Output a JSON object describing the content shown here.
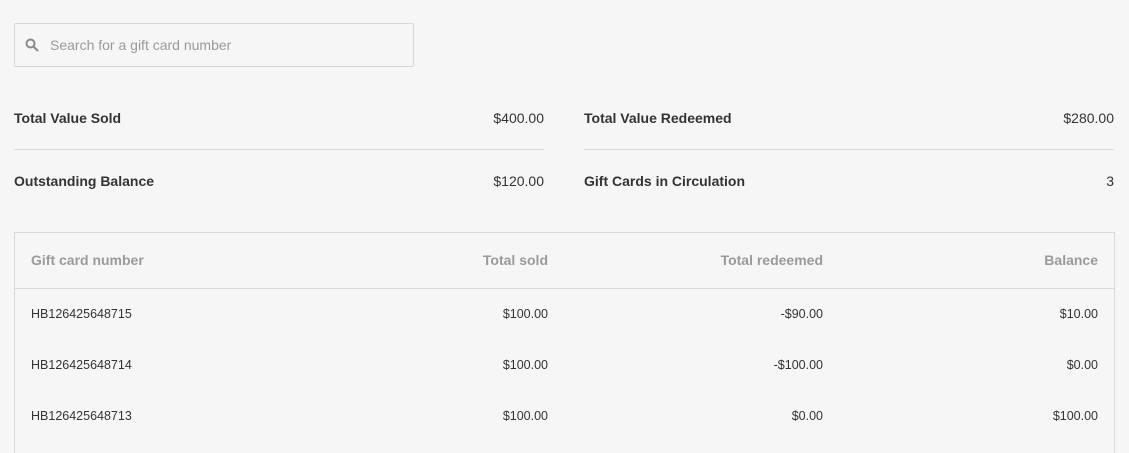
{
  "search": {
    "placeholder": "Search for a gift card number"
  },
  "stats": {
    "total_value_sold": {
      "label": "Total Value Sold",
      "value": "$400.00"
    },
    "total_value_redeemed": {
      "label": "Total Value Redeemed",
      "value": "$280.00"
    },
    "outstanding_balance": {
      "label": "Outstanding Balance",
      "value": "$120.00"
    },
    "gift_cards_in_circulation": {
      "label": "Gift Cards in Circulation",
      "value": "3"
    }
  },
  "table": {
    "headers": {
      "number": "Gift card number",
      "sold": "Total sold",
      "redeemed": "Total redeemed",
      "balance": "Balance"
    },
    "rows": [
      {
        "number": "HB126425648715",
        "sold": "$100.00",
        "redeemed": "-$90.00",
        "balance": "$10.00"
      },
      {
        "number": "HB126425648714",
        "sold": "$100.00",
        "redeemed": "-$100.00",
        "balance": "$0.00"
      },
      {
        "number": "HB126425648713",
        "sold": "$100.00",
        "redeemed": "$0.00",
        "balance": "$100.00"
      }
    ]
  },
  "icons": {
    "search": "search-icon"
  },
  "colors": {
    "background": "#f6f6f6",
    "text": "#333333",
    "muted": "#9a9a9a",
    "border": "#d9d9d9"
  }
}
